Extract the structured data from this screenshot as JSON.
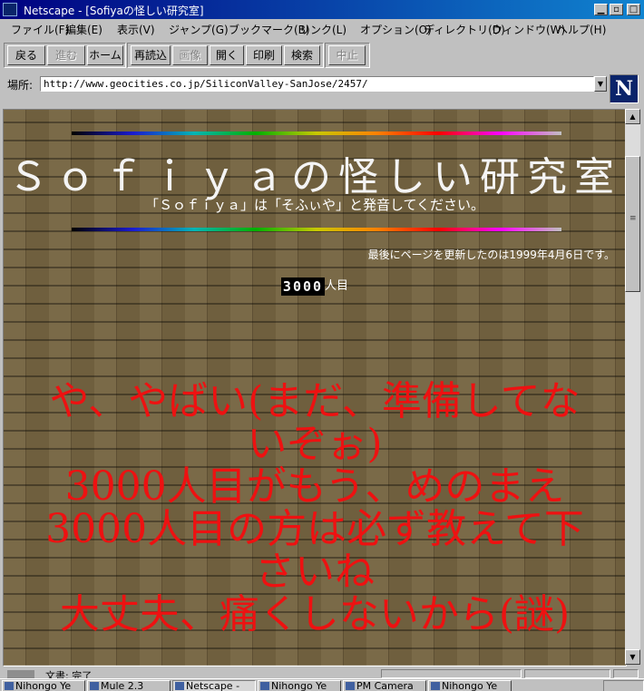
{
  "window": {
    "title": "Netscape - [Sofiyaの怪しい研究室]"
  },
  "menu": [
    "ファイル(F)",
    "編集(E)",
    "表示(V)",
    "ジャンプ(G)",
    "ブックマーク(B)",
    "リンク(L)",
    "オプション(O)",
    "ディレクトリ(D)",
    "ウィンドウ(W)",
    "ヘルプ(H)"
  ],
  "toolbar": {
    "back": "戻る",
    "forward": "進む",
    "home": "ホーム",
    "reload": "再読込",
    "images": "画像",
    "open": "開く",
    "print": "印刷",
    "find": "検索",
    "stop": "中止"
  },
  "location": {
    "label": "場所:",
    "url": "http://www.geocities.co.jp/SiliconValley-SanJose/2457/"
  },
  "brand_logo": "N",
  "page": {
    "title": "Ｓｏｆｉｙａの怪しい研究室",
    "subtitle": "「Ｓｏｆｉｙａ」は「そふぃや」と発音してください。",
    "updated": "最後にページを更新したのは1999年4月6日です。",
    "counter": "3000",
    "counter_suffix": "人目",
    "message_lines": [
      "や、やばい(まだ、準備してな",
      "いぞぉ)",
      "3000人目がもう、めのまえ",
      "3000人目の方は必ず教えて下",
      "さいね",
      "大丈夫、痛くしないから(謎)"
    ]
  },
  "status": {
    "text": "文書: 完了"
  },
  "taskbar": {
    "items": [
      "Nihongo Ye",
      "Mule 2.3",
      "Netscape -",
      "Nihongo Ye",
      "PM Camera",
      "Nihongo Ye"
    ]
  },
  "colors": {
    "message": "#ee1111",
    "title_bar": "#000080"
  }
}
